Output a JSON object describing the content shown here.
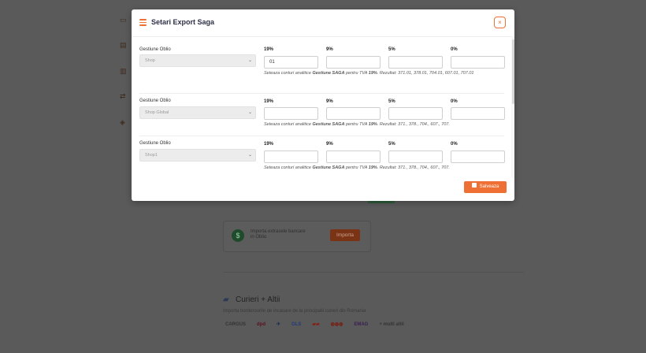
{
  "modal": {
    "title": "Setari Export Saga",
    "close_label": "×",
    "save_label": "Salveaza"
  },
  "rows": [
    {
      "label": "Gestiune Oblio",
      "selected": "Shop",
      "vat": [
        {
          "label": "19%",
          "value": "01"
        },
        {
          "label": "9%",
          "value": ""
        },
        {
          "label": "5%",
          "value": ""
        },
        {
          "label": "0%",
          "value": ""
        }
      ],
      "hint_prefix": "Seteaza conturi analitice ",
      "hint_bold1": "Gestiune SAGA",
      "hint_mid": " pentru TVA ",
      "hint_bold2": "19%",
      "hint_result_label": ". Rezultat: ",
      "hint_result": "371.01, 378.01, 704.01, 607.01, 707.01"
    },
    {
      "label": "Gestiune Oblio",
      "selected": "Shop Global",
      "vat": [
        {
          "label": "19%",
          "value": ""
        },
        {
          "label": "9%",
          "value": ""
        },
        {
          "label": "5%",
          "value": ""
        },
        {
          "label": "0%",
          "value": ""
        }
      ],
      "hint_prefix": "Seteaza conturi analitice ",
      "hint_bold1": "Gestiune SAGA",
      "hint_mid": " pentru TVA ",
      "hint_bold2": "19%",
      "hint_result_label": ". Rezultat: ",
      "hint_result": "371., 378., 704., 607., 707."
    },
    {
      "label": "Gestiune Oblio",
      "selected": "Shop1",
      "vat": [
        {
          "label": "19%",
          "value": ""
        },
        {
          "label": "9%",
          "value": ""
        },
        {
          "label": "5%",
          "value": ""
        },
        {
          "label": "0%",
          "value": ""
        }
      ],
      "hint_prefix": "Seteaza conturi analitice ",
      "hint_bold1": "Gestiune SAGA",
      "hint_mid": " pentru TVA ",
      "hint_bold2": "19%",
      "hint_result_label": ". Rezultat: ",
      "hint_result": "371., 378., 704., 607., 707."
    }
  ],
  "background": {
    "import_card_text": "Importa extrasele bancare in Oblio",
    "import_button": "Importa",
    "section_title": "Curieri + Altii",
    "section_subtitle": "Importa borderourile de incasare de la principalii curieri din Romania",
    "logos": [
      "CARGUS",
      "dpd",
      "GLS",
      "EMAG",
      "+ multi altii"
    ]
  },
  "colors": {
    "accent": "#ee7034",
    "title": "#2c2f45"
  }
}
